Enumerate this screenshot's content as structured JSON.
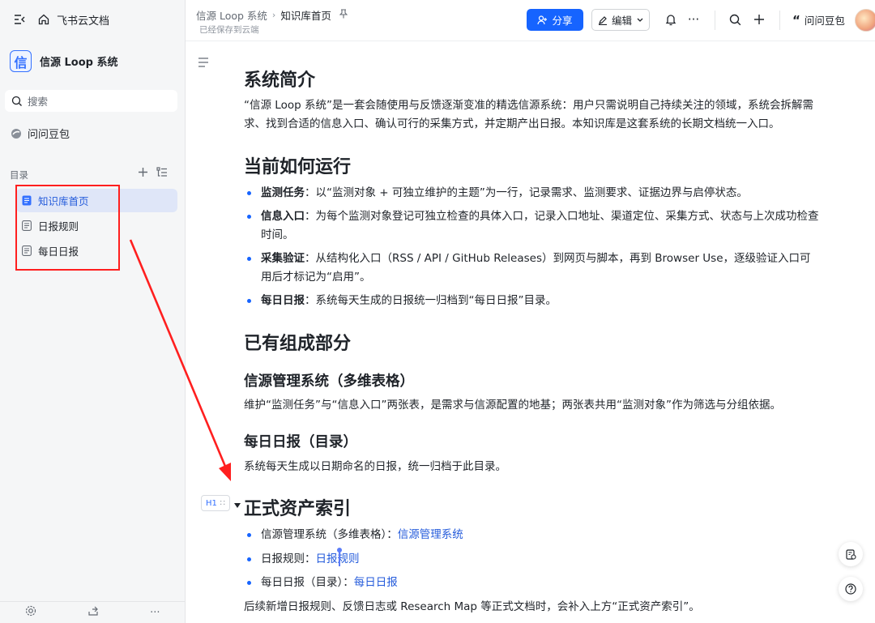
{
  "sidebar": {
    "app_name": "飞书云文档",
    "space": {
      "logo_char": "信",
      "name": "信源 Loop 系统"
    },
    "search_placeholder": "搜索",
    "wenwen": "问问豆包",
    "toc_label": "目录",
    "items": [
      {
        "label": "知识库首页",
        "active": true
      },
      {
        "label": "日报规则",
        "active": false
      },
      {
        "label": "每日日报",
        "active": false
      }
    ]
  },
  "header": {
    "breadcrumb": [
      "信源 Loop 系统",
      "知识库首页"
    ],
    "saved_status": "已经保存到云端",
    "share_label": "分享",
    "edit_label": "编辑",
    "wenwen_label": "问问豆包"
  },
  "doc": {
    "s1": {
      "title": "系统简介",
      "p": "“信源 Loop 系统”是一套会随使用与反馈逐渐变准的精选信源系统：用户只需说明自己持续关注的领域，系统会拆解需求、找到合适的信息入口、确认可行的采集方式，并定期产出日报。本知识库是这套系统的长期文档统一入口。"
    },
    "s2": {
      "title": "当前如何运行",
      "bullets": [
        {
          "term": "监测任务",
          "text": "：以“监测对象 + 可独立维护的主题”为一行，记录需求、监测要求、证据边界与启停状态。"
        },
        {
          "term": "信息入口",
          "text": "：为每个监测对象登记可独立检查的具体入口，记录入口地址、渠道定位、采集方式、状态与上次成功检查时间。"
        },
        {
          "term": "采集验证",
          "text": "：从结构化入口（RSS / API / GitHub Releases）到网页与脚本，再到 Browser Use，逐级验证入口可用后才标记为“启用”。"
        },
        {
          "term": "每日日报",
          "text": "：系统每天生成的日报统一归档到“每日日报”目录。"
        }
      ]
    },
    "s3": {
      "title": "已有组成部分",
      "sub1": {
        "title": "信源管理系统（多维表格）",
        "p": "维护“监测任务”与“信息入口”两张表，是需求与信源配置的地基；两张表共用“监测对象”作为筛选与分组依据。"
      },
      "sub2": {
        "title": "每日日报（目录）",
        "p": "系统每天生成以日期命名的日报，统一归档于此目录。"
      }
    },
    "s4": {
      "block_tag": "H1",
      "title": "正式资产索引",
      "bullets": [
        {
          "text": "信源管理系统（多维表格）：",
          "link": "信源管理系统"
        },
        {
          "text": "日报规则：",
          "link": "日报规则"
        },
        {
          "text": "每日日报（目录）：",
          "link": "每日日报"
        }
      ],
      "footer": "后续新增日报规则、反馈日志或 Research Map 等正式文档时，会补入上方“正式资产索引”。"
    }
  },
  "colors": {
    "accent": "#1664ff",
    "link": "#245bdb",
    "annotation": "#ff1f1f"
  }
}
